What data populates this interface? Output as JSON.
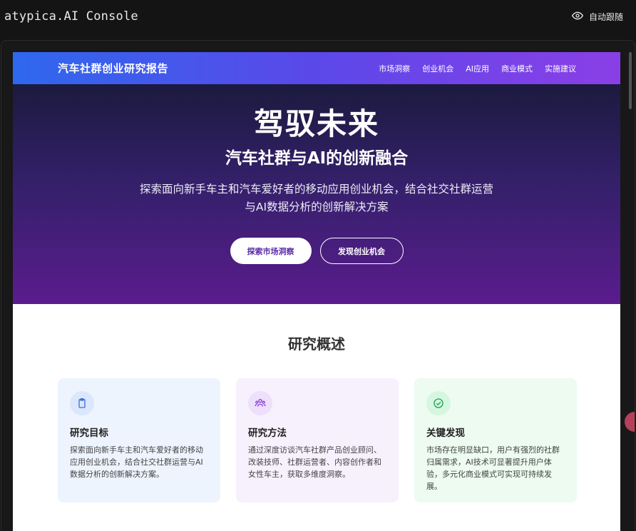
{
  "console": {
    "title": "atypica.AI Console",
    "follow_label": "自动跟随",
    "follow_icon": "eye-icon"
  },
  "site": {
    "title": "汽车社群创业研究报告",
    "nav": [
      "市场洞察",
      "创业机会",
      "AI应用",
      "商业模式",
      "实施建议"
    ]
  },
  "hero": {
    "headline": "驾驭未来",
    "subheadline": "汽车社群与AI的创新融合",
    "description_line1": "探索面向新手车主和汽车爱好者的移动应用创业机会，结合社交社群运营",
    "description_line2": "与AI数据分析的创新解决方案",
    "primary_button": "探索市场洞察",
    "secondary_button": "发现创业机会"
  },
  "overview": {
    "title": "研究概述",
    "cards": [
      {
        "icon": "clipboard-icon",
        "title": "研究目标",
        "text": "探索面向新手车主和汽车爱好者的移动应用创业机会，结合社交社群运营与AI数据分析的创新解决方案。"
      },
      {
        "icon": "users-icon",
        "title": "研究方法",
        "text": "通过深度访谈汽车社群产品创业顾问、改装技师、社群运营者、内容创作者和女性车主，获取多维度洞察。"
      },
      {
        "icon": "check-circle-icon",
        "title": "关键发现",
        "text": "市场存在明显缺口，用户有强烈的社群归属需求，AI技术可显著提升用户体验，多元化商业模式可实现可持续发展。"
      }
    ]
  },
  "colors": {
    "header_start": "#2e68ee",
    "header_end": "#8a3fe6",
    "hero_top": "#1b1a3e",
    "hero_bottom": "#5a1c8e",
    "primary_button_text": "#5b2ea6"
  }
}
